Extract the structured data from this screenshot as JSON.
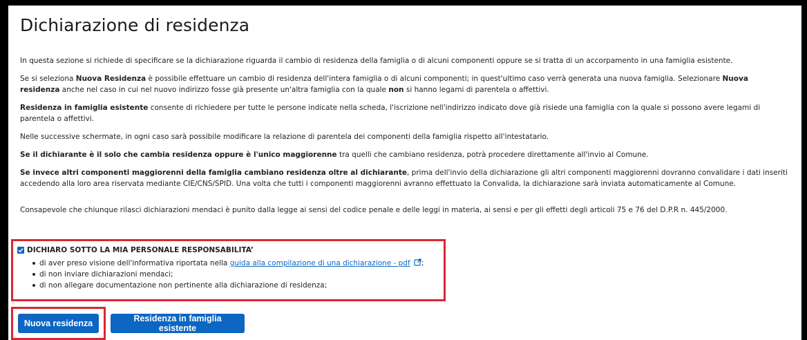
{
  "page": {
    "title": "Dichiarazione di residenza"
  },
  "paragraphs": {
    "p1": "In questa sezione si richiede di specificare se la dichiarazione riguarda il cambio di residenza della famiglia o di alcuni componenti oppure se si tratta di un accorpamento in una famiglia esistente.",
    "p2_a": "Se si seleziona ",
    "p2_b": "Nuova Residenza",
    "p2_c": " è possibile effettuare un cambio di residenza dell'intera famiglia o di alcuni componenti; in quest'ultimo caso verrà generata una nuova famiglia. Selezionare ",
    "p2_d": "Nuova residenza",
    "p2_e": " anche nel caso in cui nel nuovo indirizzo fosse già presente un'altra famiglia con la quale ",
    "p2_f": "non",
    "p2_g": " si hanno legami di parentela o affettivi.",
    "p3_a": "Residenza in famiglia esistente",
    "p3_b": " consente di richiedere per tutte le persone indicate nella scheda, l'iscrizione nell'indirizzo indicato dove già risiede una famiglia con la quale si possono avere legami di parentela o affettivi.",
    "p4": "Nelle successive schermate, in ogni caso sarà possibile modificare la relazione di parentela dei componenti della famiglia rispetto all'intestatario.",
    "p5_a": "Se il dichiarante è il solo che cambia residenza oppure è l'unico maggiorenne",
    "p5_b": " tra quelli che cambiano residenza, potrà procedere direttamente all'invio al Comune.",
    "p6_a": "Se invece altri componenti maggiorenni della famiglia cambiano residenza oltre al dichiarante",
    "p6_b": ", prima dell'invio della dichiarazione gli altri componenti maggiorenni dovranno convalidare i dati inseriti accedendo alla loro area riservata mediante CIE/CNS/SPID. Una volta che tutti i componenti maggiorenni avranno effettuato la Convalida, la dichiarazione sarà inviata automaticamente al Comune.",
    "p7": "Consapevole che chiunque rilasci dichiarazioni mendaci è punito dalla legge ai sensi del codice penale e delle leggi in materia, ai sensi e per gli effetti degli articoli 75 e 76 del D.P.R n. 445/2000."
  },
  "declaration": {
    "checked": true,
    "heading": "DICHIARO SOTTO LA MIA PERSONALE RESPONSABILITA’",
    "item1_a": "di aver preso visione dell'informativa riportata nella ",
    "item1_link": "guida alla compilazione di una dichiarazione - pdf",
    "item1_end": ";",
    "item2": "di non inviare dichiarazioni mendaci;",
    "item3": "di non allegare documentazione non pertinente alla dichiarazione di residenza;"
  },
  "buttons": {
    "nuova": "Nuova residenza",
    "esistente": "Residenza in famiglia esistente"
  },
  "colors": {
    "primary": "#0d66c2",
    "highlight": "#d7282f",
    "frame": "#000000"
  },
  "icons": {
    "external_link": "external-link-icon",
    "checkbox": "checkbox-checked-icon"
  }
}
